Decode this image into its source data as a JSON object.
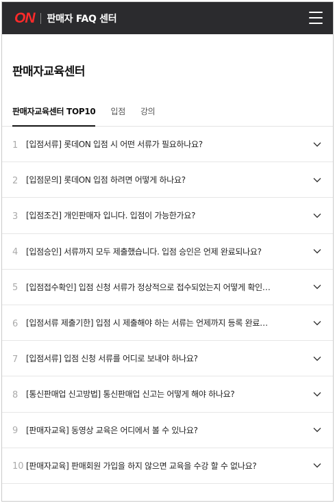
{
  "header": {
    "logo_text": "ON",
    "title": "판매자 FAQ 센터",
    "menu_icon": "hamburger-menu-icon",
    "brand_color": "#ff2a2a",
    "bg_color": "#2b2b2e"
  },
  "page": {
    "title": "판매자교육센터"
  },
  "tabs": [
    {
      "label": "판매자교육센터 TOP10",
      "active": true
    },
    {
      "label": "입점",
      "active": false
    },
    {
      "label": "강의",
      "active": false
    }
  ],
  "faq": [
    {
      "num": "1",
      "question": "[입점서류] 롯데ON 입점 시 어떤 서류가 필요하나요?"
    },
    {
      "num": "2",
      "question": "[입점문의] 롯데ON 입점 하려면 어떻게 하나요?"
    },
    {
      "num": "3",
      "question": "[입점조건] 개인판매자 입니다. 입점이 가능한가요?"
    },
    {
      "num": "4",
      "question": "[입점승인] 서류까지 모두 제출했습니다. 입점 승인은 언제 완료되나요?"
    },
    {
      "num": "5",
      "question": "[입점접수확인] 입점 신청 서류가 정상적으로 접수되었는지 어떻게 확인…"
    },
    {
      "num": "6",
      "question": "[입점서류 제출기한] 입점 시 제출해야 하는 서류는 언제까지 등록 완료…"
    },
    {
      "num": "7",
      "question": "[입점서류] 입점 신청 서류를 어디로 보내야 하나요?"
    },
    {
      "num": "8",
      "question": "[통신판매업 신고방법] 통신판매업 신고는 어떻게 해야 하나요?"
    },
    {
      "num": "9",
      "question": "[판매자교육] 동영상 교육은 어디에서 볼 수 있나요?"
    },
    {
      "num": "10",
      "question": "[판매자교육] 판매회원 가입을 하지 않으면 교육을 수강 할 수 없나요?"
    }
  ],
  "icons": {
    "expand": "chevron-down-icon"
  }
}
